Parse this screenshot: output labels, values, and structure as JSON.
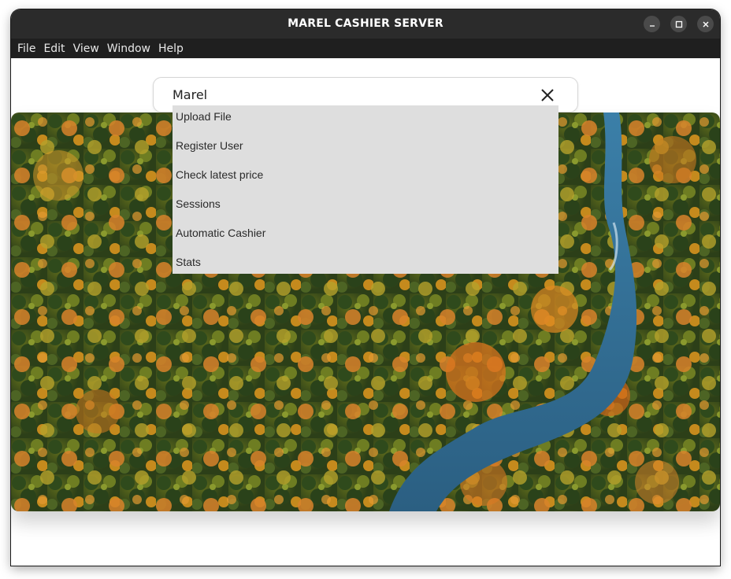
{
  "window": {
    "title": "MAREL CASHIER SERVER",
    "controls": [
      "minimize-icon",
      "maximize-icon",
      "close-icon"
    ]
  },
  "menubar": {
    "items": [
      "File",
      "Edit",
      "View",
      "Window",
      "Help"
    ]
  },
  "search": {
    "value": "Marel",
    "clear_icon": "close-icon"
  },
  "dropdown": {
    "items": [
      "Upload File",
      "Register User",
      "Check latest price",
      "Sessions",
      "Automatic Cashier",
      "Stats"
    ]
  },
  "hero": {
    "image": "aerial-autumn-forest-river"
  },
  "colors": {
    "titlebar": "#2b2b2b",
    "menubar": "#1f1f1f",
    "dropdown": "#dedede",
    "river": "#2f6f95"
  }
}
